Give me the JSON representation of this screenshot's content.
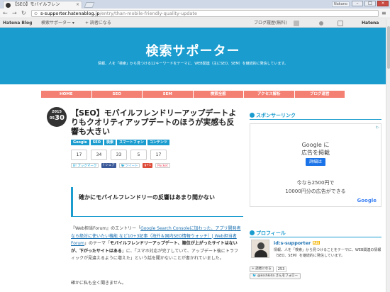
{
  "browser": {
    "tab_title": "【SEO】モバイルフレン",
    "tab_close": "×",
    "user_chip": "Nakano",
    "window_buttons": {
      "minimize": "–",
      "maximize": "□",
      "close": "×"
    },
    "back": "←",
    "forward": "→",
    "reload": "↻",
    "lock": "🔍",
    "url_host": "s-supporter.hatenablog.jp",
    "url_path": "/entry/than-mobile-friendly-quality-update",
    "menu": "≡"
  },
  "hatena_bar": {
    "logo": "Hatena Blog",
    "search_support": "検索サポーター ▾",
    "subscribe": "+ 読者になる",
    "history": "ブログ履歴",
    "notices": "(無料)",
    "brand": "Hatena"
  },
  "site": {
    "title": "検索サポーター",
    "description": "情報、人を「検索」から見つける12キーワードをテーマに、WEB関連（主にSEO、SEM）を継続的に発信しています。"
  },
  "global_nav": [
    "HOME",
    "SEO",
    "SEM",
    "検索全般",
    "アクセス解析",
    "ブログ運営"
  ],
  "post": {
    "date": {
      "year": "2015",
      "month": "05",
      "day": "30"
    },
    "title": "【SEO】モバイルフレンドリーアップデートよりもクオリティアップデートのほうが実感も反響も大きい",
    "tags": [
      "Google",
      "SEO",
      "検索",
      "スマートフォン",
      "コンテンツ"
    ],
    "counts": [
      "17",
      "34",
      "33",
      "5",
      "17"
    ],
    "share_buttons": [
      "B! ブックマーク",
      "f シェア",
      "🐦ツイート",
      "g+1",
      "Pocket"
    ],
    "subheading": "確かにモバイルフレンドリーの反響はあまり聞かない",
    "body_prefix": "『Web担当Forum』のエントリー「",
    "body_link": "Google Search Consoleに加わった、アプリ開発者なら絶対に使いたい機能 など10+3記事（海外＆国内SEO情報ウォッチ）| Web担当者Forum",
    "body_mid": "」のテーマ「",
    "body_bold": "モバイルフレンドリーアップデート、順位が上がったサイトはないが、下がったサイトはある",
    "body_suffix": "」に、「スマホ対応が完了していて、アップデート後にトラフィックが見違えるように増えた」という話を聞かないことが書かれていました。",
    "body_more": "確かに私も全く聞きません。"
  },
  "sidebar": {
    "sponsor_heading": "スポンサーリンク",
    "ad": {
      "line1": "Google に",
      "line2": "広告を掲載",
      "button": "詳細は",
      "price1": "今なら2500円で",
      "price2": "10000円分の広告ができる",
      "logo": "Google",
      "adchoice": "i▷"
    },
    "profile_heading": "プロフィール",
    "profile_name": "id:s-supporter",
    "profile_badge": "RSS",
    "profile_desc": "情報、人を「検索」から見つけることをテーマに、WEB関連の情報（SEO、SEM）を継続的に発信しています。",
    "readers_button": "+ 読者になる",
    "readers_count": "253",
    "follow_button": "@ksshkida さんをフォロー"
  }
}
